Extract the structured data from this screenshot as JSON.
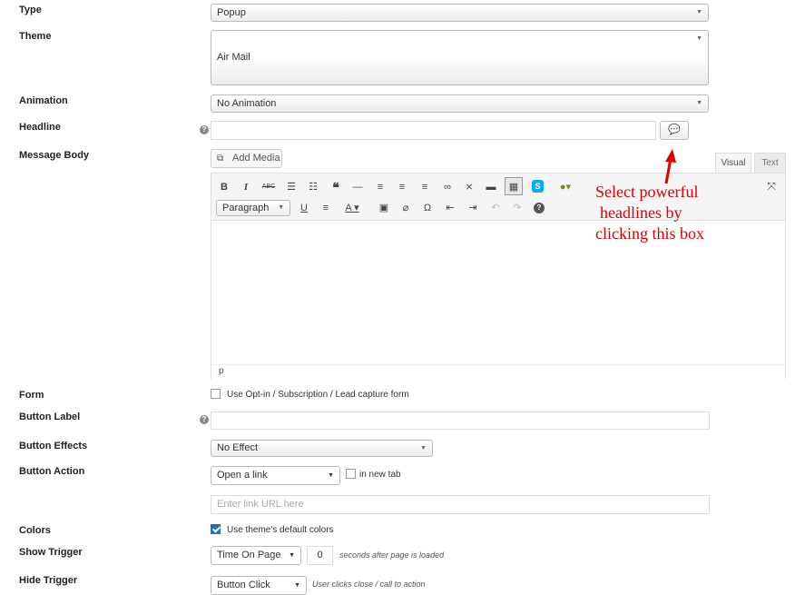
{
  "fields": {
    "type": {
      "label": "Type",
      "value": "Popup"
    },
    "theme": {
      "label": "Theme",
      "value": "Air Mail"
    },
    "animation": {
      "label": "Animation",
      "value": "No Animation"
    },
    "headline": {
      "label": "Headline",
      "value": ""
    },
    "message_body": {
      "label": "Message Body"
    },
    "form": {
      "label": "Form",
      "checkbox_label": "Use Opt-in / Subscription / Lead capture form",
      "checked": false
    },
    "button_label": {
      "label": "Button Label",
      "value": ""
    },
    "button_effects": {
      "label": "Button Effects",
      "value": "No Effect"
    },
    "button_action": {
      "label": "Button Action",
      "value": "Open a link",
      "new_tab_label": "in new tab",
      "url_placeholder": "Enter link URL here"
    },
    "colors": {
      "label": "Colors",
      "checkbox_label": "Use theme's default colors",
      "checked": true
    },
    "show_trigger": {
      "label": "Show Trigger",
      "value": "Time On Page",
      "seconds": "0",
      "suffix": "seconds after page is loaded"
    },
    "hide_trigger": {
      "label": "Hide Trigger",
      "value": "Button Click",
      "suffix": "User clicks close / call to action"
    }
  },
  "editor": {
    "add_media": "Add Media",
    "tab_visual": "Visual",
    "tab_text": "Text",
    "format_select": "Paragraph",
    "status_path": "p",
    "toolbar_row1": [
      {
        "name": "bold-icon",
        "glyph": "B"
      },
      {
        "name": "italic-icon",
        "glyph": "I"
      },
      {
        "name": "strikethrough-icon",
        "glyph": "ABC"
      },
      {
        "name": "bullet-list-icon",
        "glyph": "☰"
      },
      {
        "name": "numbered-list-icon",
        "glyph": "☷"
      },
      {
        "name": "blockquote-icon",
        "glyph": "❝"
      },
      {
        "name": "horizontal-rule-icon",
        "glyph": "—"
      },
      {
        "name": "align-left-icon",
        "glyph": "≡"
      },
      {
        "name": "align-center-icon",
        "glyph": "≡"
      },
      {
        "name": "align-right-icon",
        "glyph": "≡"
      },
      {
        "name": "link-icon",
        "glyph": "🔗"
      },
      {
        "name": "unlink-icon",
        "glyph": "⛓"
      },
      {
        "name": "read-more-icon",
        "glyph": "▬"
      },
      {
        "name": "toolbar-toggle-icon",
        "glyph": "▦"
      }
    ],
    "toolbar_row2": [
      {
        "name": "underline-icon",
        "glyph": "U"
      },
      {
        "name": "justify-icon",
        "glyph": "≡"
      },
      {
        "name": "text-color-icon",
        "glyph": "A"
      },
      {
        "name": "paste-text-icon",
        "glyph": "📋"
      },
      {
        "name": "clear-formatting-icon",
        "glyph": "⌫"
      },
      {
        "name": "special-character-icon",
        "glyph": "Ω"
      },
      {
        "name": "outdent-icon",
        "glyph": "⇤"
      },
      {
        "name": "indent-icon",
        "glyph": "⇥"
      },
      {
        "name": "undo-icon",
        "glyph": "↶"
      },
      {
        "name": "redo-icon",
        "glyph": "↷"
      },
      {
        "name": "help-icon",
        "glyph": "?"
      }
    ]
  },
  "annotation": {
    "lines": [
      "Select powerful",
      "headlines by",
      "clicking this box"
    ],
    "color": "#e00000"
  },
  "colors": {
    "accent": "#2271b1",
    "skype_blue": "#00aff0"
  }
}
